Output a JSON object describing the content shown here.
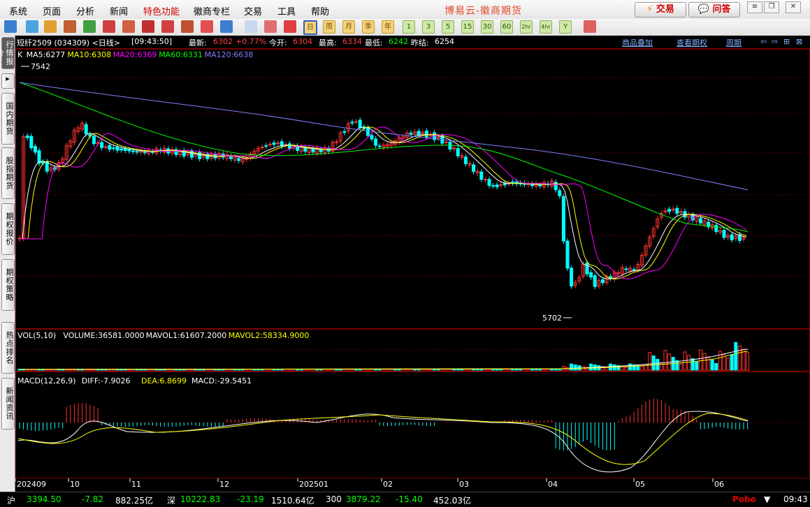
{
  "menu": [
    "系统",
    "页面",
    "分析",
    "新闻",
    "特色功能",
    "徽商专栏",
    "交易",
    "工具",
    "帮助"
  ],
  "app_title": "博易云-徽商期货",
  "top_buttons": {
    "trade": "交易",
    "ask": "问答"
  },
  "toolbar_periods": [
    "日",
    "周",
    "月",
    "季",
    "年",
    "1",
    "3",
    "5",
    "15",
    "30",
    "60",
    "2hr",
    "4hr",
    "Y"
  ],
  "side_tabs": [
    "行情报价",
    "国内期货",
    "股指期货",
    "期权报价",
    "期权策略",
    "热点排名",
    "新闻资讯"
  ],
  "info": {
    "contract": "短纤2509 (034309) <日线>",
    "time": "[09:43:50]",
    "last_label": "最新:",
    "last": "6302",
    "change": "+0.77%",
    "open_label": "今开:",
    "open": "6304",
    "high_label": "最高:",
    "high": "6334",
    "low_label": "最低:",
    "low": "6242",
    "prev_label": "昨结:",
    "prev": "6254",
    "links": [
      "商品叠加",
      "查看期权",
      "周期"
    ]
  },
  "ma_legend": [
    {
      "label": "K",
      "color": "#ffffff"
    },
    {
      "label": "MA5:6277",
      "color": "#ffffff"
    },
    {
      "label": "MA10:6308",
      "color": "#ffff00"
    },
    {
      "label": "MA20:6369",
      "color": "#ff00ff"
    },
    {
      "label": "MA60:6331",
      "color": "#00ff00"
    },
    {
      "label": "MA120:6638",
      "color": "#7f7fff"
    }
  ],
  "vol_legend": [
    {
      "label": "VOL(5,10)",
      "color": "#ffffff"
    },
    {
      "label": "VOLUME:36581.0000",
      "color": "#ffffff"
    },
    {
      "label": "MAVOL1:61607.2000",
      "color": "#ffffff"
    },
    {
      "label": "MAVOL2:58334.9000",
      "color": "#ffff00"
    }
  ],
  "macd_legend": [
    {
      "label": "MACD(12,26,9)",
      "color": "#ffffff"
    },
    {
      "label": "DIFF:-7.9026",
      "color": "#ffffff"
    },
    {
      "label": "DEA:6.8699",
      "color": "#ffff00"
    },
    {
      "label": "MACD:-29.5451",
      "color": "#ffffff"
    }
  ],
  "chart_annotations": {
    "high": "7542",
    "low": "5702"
  },
  "x_labels": [
    "202409",
    "10",
    "11",
    "12",
    "202501",
    "02",
    "03",
    "04",
    "05",
    "06"
  ],
  "colors": {
    "up": "#ff3232",
    "down": "#00ffff",
    "grid": "#7a0000"
  },
  "status": {
    "sh_label": "沪",
    "sh_value": "3394.50",
    "sh_change": "-7.82",
    "sh_amount": "882.25亿",
    "sz_label": "深",
    "sz_value": "10222.83",
    "sz_change": "-23.19",
    "sz_amount": "1510.64亿",
    "i300_label": "300",
    "i300_value": "3879.22",
    "i300_change": "-15.40",
    "i300_amount": "452.03亿",
    "brand": "Pobo",
    "clock": "09:43"
  }
}
